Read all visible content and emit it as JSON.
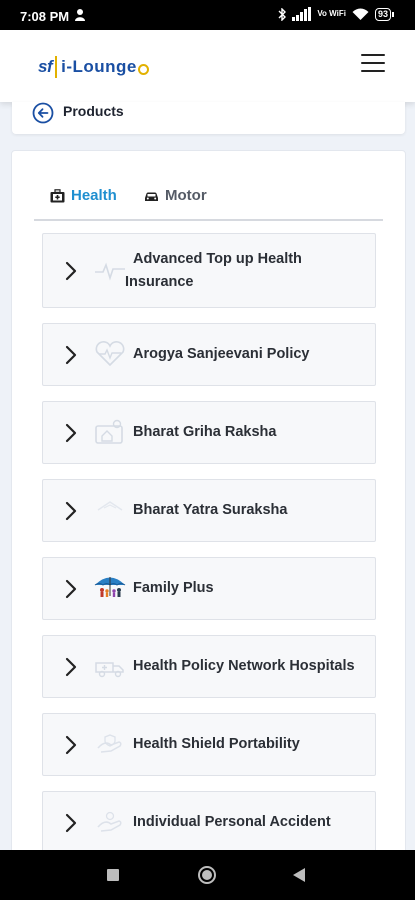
{
  "status_bar": {
    "time": "7:08 PM",
    "network": "Vo WiFi",
    "battery": "93"
  },
  "header": {
    "logo_brand": "sf",
    "logo_text": "i-Lounge",
    "menu_icon": "hamburger-menu-icon"
  },
  "breadcrumb": {
    "title": "Products",
    "back_icon": "back-arrow-circle-icon"
  },
  "tabs": [
    {
      "label": "Health",
      "icon": "medical-kit-icon",
      "active": true
    },
    {
      "label": "Motor",
      "icon": "car-icon",
      "active": false
    }
  ],
  "colors": {
    "accent": "#1f8fd0",
    "brand": "#1a4fa3",
    "brand_gold": "#e2b100"
  },
  "products": [
    {
      "label": "Advanced Top up Health Insurance",
      "line1": "Advanced Top up Health",
      "line2": "Insurance",
      "icon": "heartbeat-icon"
    },
    {
      "label": "Arogya Sanjeevani Policy",
      "icon": "heart-pulse-icon"
    },
    {
      "label": "Bharat Griha Raksha",
      "icon": "house-protection-icon"
    },
    {
      "label": "Bharat Yatra Suraksha",
      "icon": "travel-icon"
    },
    {
      "label": "Family Plus",
      "icon": "family-umbrella-icon"
    },
    {
      "label": "Health Policy Network Hospitals",
      "icon": "ambulance-icon"
    },
    {
      "label": "Health Shield Portability",
      "icon": "shield-hand-icon"
    },
    {
      "label": "Individual Personal Accident",
      "icon": "accident-icon"
    }
  ],
  "nav": {
    "recents": "recents-square-icon",
    "home": "home-circle-icon",
    "back": "back-triangle-icon"
  }
}
